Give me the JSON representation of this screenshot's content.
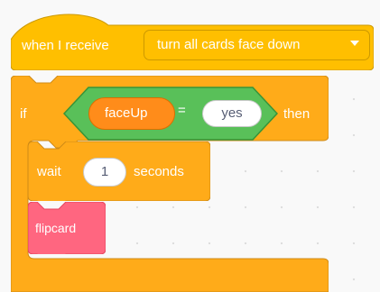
{
  "hat": {
    "label": "when I receive",
    "message": "turn all cards face down"
  },
  "if_block": {
    "if_label": "if",
    "then_label": "then",
    "condition": {
      "variable": "faceUp",
      "operator": "=",
      "value": "yes"
    }
  },
  "wait_block": {
    "label": "wait",
    "value": "1",
    "unit_label": "seconds"
  },
  "custom_block": {
    "label": "flipcard"
  },
  "colors": {
    "events": "#ffbf00",
    "control": "#ffab19",
    "operators": "#59c059",
    "variables": "#ff8c1a",
    "custom": "#ff6680",
    "canvas": "#f9f9f9"
  }
}
